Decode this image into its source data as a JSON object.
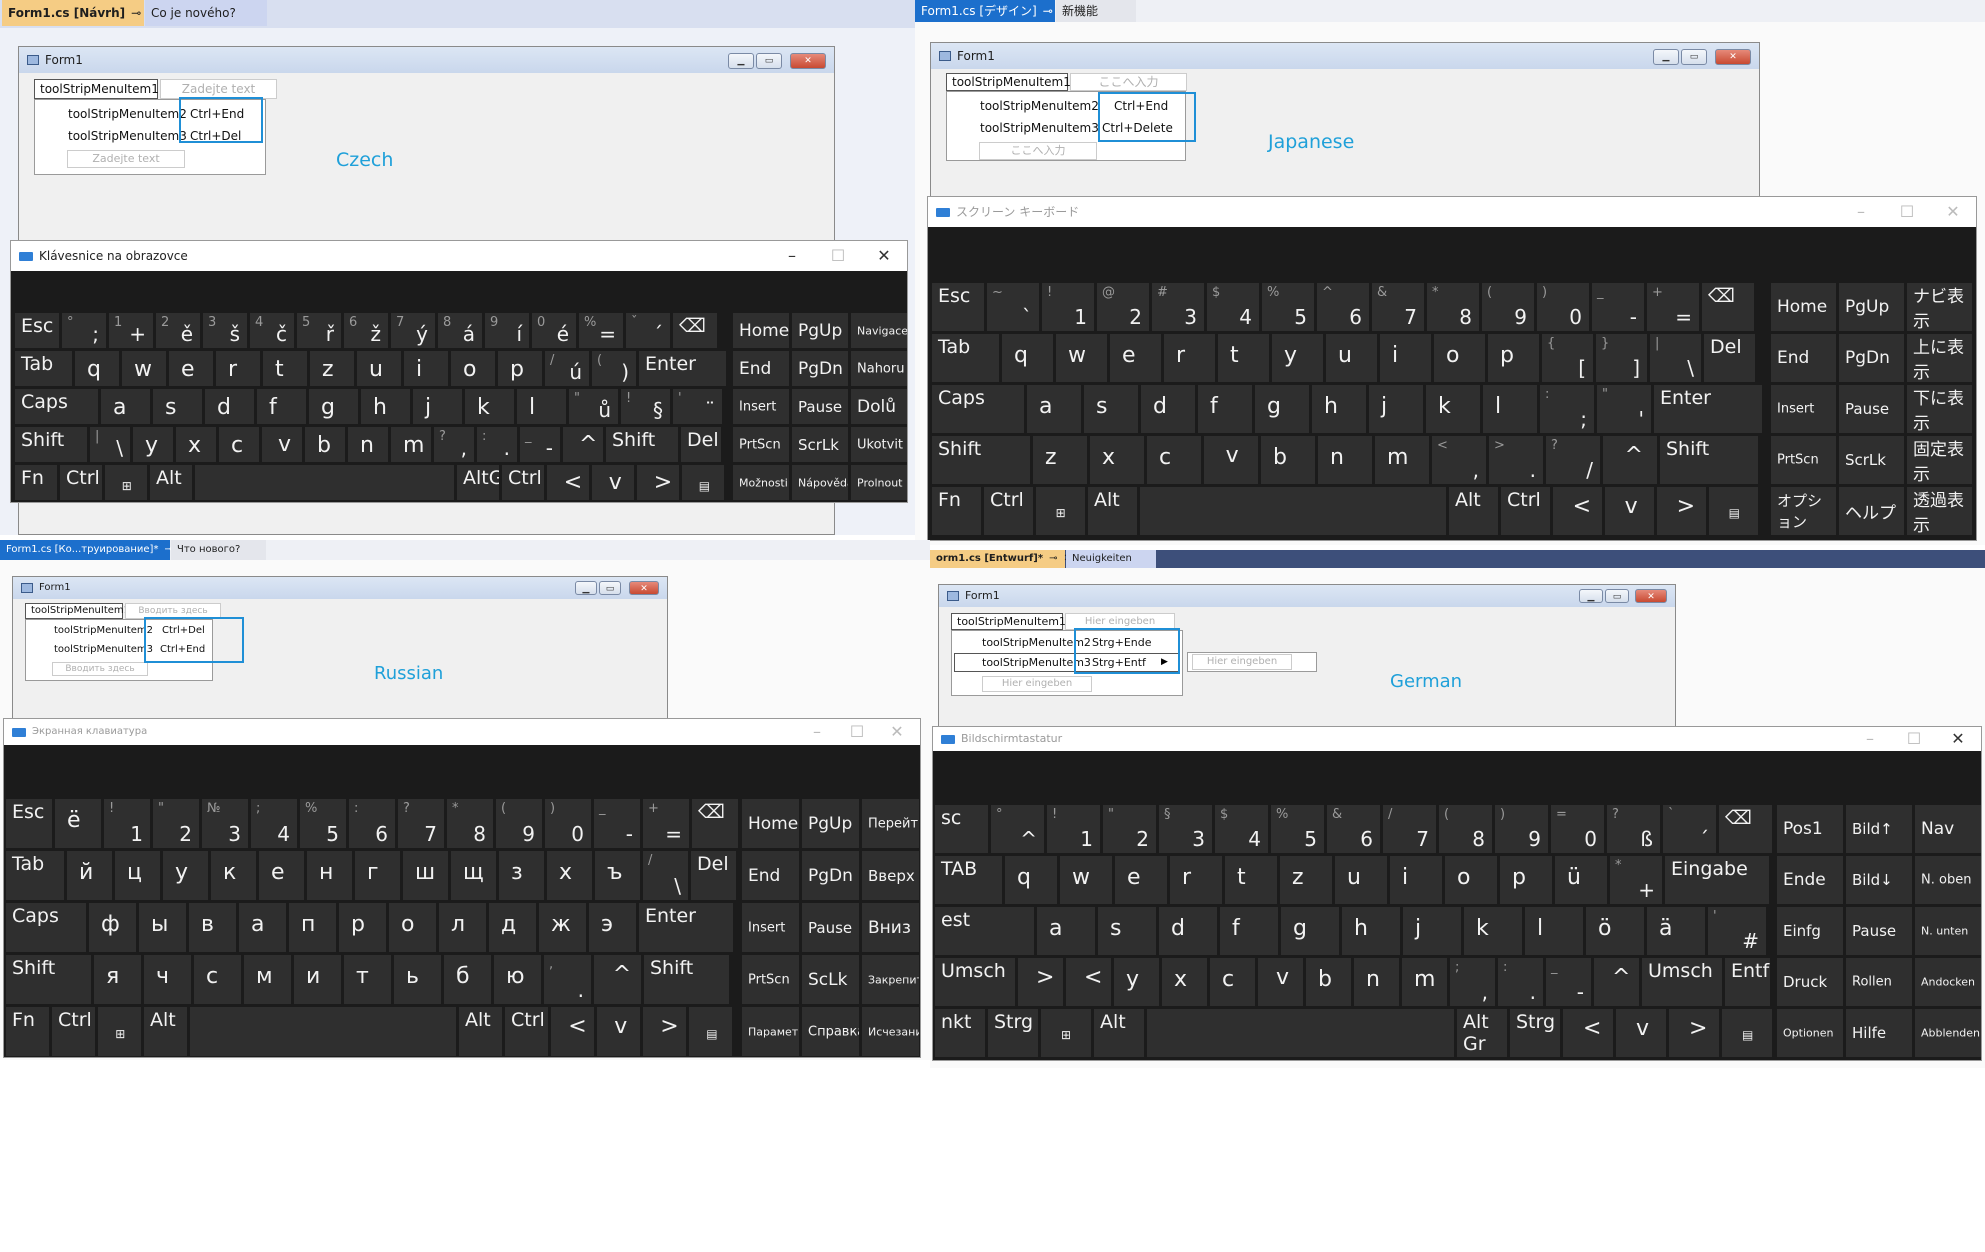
{
  "panels": {
    "czech": {
      "tabs": [
        "Form1.cs [Návrh]",
        "Co je nového?"
      ],
      "form_title": "Form1",
      "menu": {
        "item1": "toolStripMenuItem1",
        "placeholder": "Zadejte text"
      },
      "dropdown": [
        {
          "label": "toolStripMenuItem2",
          "shortcut": "Ctrl+End"
        },
        {
          "label": "toolStripMenuItem3",
          "shortcut": "Ctrl+Del"
        }
      ],
      "dropdown_placeholder": "Zadejte text",
      "language_label": "Czech",
      "osk_title": "Klávesnice na obrazovce",
      "keys": {
        "row1": [
          "Esc",
          "°;",
          "1+",
          "2ě",
          "3š",
          "4č",
          "5ř",
          "6ž",
          "7ý",
          "8á",
          "9í",
          "0é",
          "%=",
          "ˇ´",
          "⌫"
        ],
        "row2": [
          "Tab",
          "q",
          "w",
          "e",
          "r",
          "t",
          "z",
          "u",
          "i",
          "o",
          "p",
          "/ú",
          "()",
          "Enter"
        ],
        "row3": [
          "Caps",
          "a",
          "s",
          "d",
          "f",
          "g",
          "h",
          "j",
          "k",
          "l",
          "\"ů",
          "!§",
          "'¨"
        ],
        "row4": [
          "Shift",
          "|\\",
          "y",
          "x",
          "c",
          "v",
          "b",
          "n",
          "m",
          "?,",
          ":.",
          "_-",
          "^",
          "Shift",
          "Del"
        ],
        "row5": [
          "Fn",
          "Ctrl",
          "⊞",
          "Alt",
          "AltGr",
          "Ctrl",
          "<",
          "v",
          ">",
          "▤"
        ],
        "nav": [
          "Home",
          "PgUp",
          "Navigace",
          "End",
          "PgDn",
          "Nahoru",
          "Insert",
          "Pause",
          "Dolů",
          "PrtScn",
          "ScrLk",
          "Ukotvit",
          "Možnosti",
          "Nápověda",
          "Prolnout"
        ]
      }
    },
    "japanese": {
      "tabs": [
        "Form1.cs [デザイン]",
        "新機能"
      ],
      "form_title": "Form1",
      "menu": {
        "item1": "toolStripMenuItem1",
        "placeholder": "ここへ入力"
      },
      "dropdown": [
        {
          "label": "toolStripMenuItem2",
          "shortcut": "Ctrl+End"
        },
        {
          "label": "toolStripMenuItem3",
          "shortcut": "Ctrl+Delete"
        }
      ],
      "dropdown_placeholder": "ここへ入力",
      "language_label": "Japanese",
      "osk_title": "スクリーン キーボード",
      "keys": {
        "row1": [
          "Esc",
          "~`",
          "!1",
          "@2",
          "#3",
          "$4",
          "%5",
          "^6",
          "&7",
          "*8",
          "(9",
          ")0",
          "_-",
          "+=",
          "⌫"
        ],
        "row2": [
          "Tab",
          "q",
          "w",
          "e",
          "r",
          "t",
          "y",
          "u",
          "i",
          "o",
          "p",
          "{[",
          "}]",
          "|\\",
          "Del"
        ],
        "row3": [
          "Caps",
          "a",
          "s",
          "d",
          "f",
          "g",
          "h",
          "j",
          "k",
          "l",
          ":;",
          "\"'",
          "Enter"
        ],
        "row4": [
          "Shift",
          "z",
          "x",
          "c",
          "v",
          "b",
          "n",
          "m",
          "<,",
          ">.",
          "?/",
          "^",
          "Shift"
        ],
        "row5": [
          "Fn",
          "Ctrl",
          "⊞",
          "Alt",
          "Alt",
          "Ctrl",
          "<",
          "v",
          ">",
          "▤"
        ],
        "nav": [
          "Home",
          "PgUp",
          "ナビ表示",
          "End",
          "PgDn",
          "上に表示",
          "Insert",
          "Pause",
          "下に表示",
          "PrtScn",
          "ScrLk",
          "固定表示",
          "オプション",
          "ヘルプ",
          "透過表示"
        ]
      }
    },
    "russian": {
      "tabs": [
        "Form1.cs [Ко...труирование]*",
        "Что нового?"
      ],
      "form_title": "Form1",
      "menu": {
        "item1": "toolStripMenuItem1",
        "placeholder": "Вводить здесь"
      },
      "dropdown": [
        {
          "label": "toolStripMenuItem2",
          "shortcut": "Ctrl+Del"
        },
        {
          "label": "toolStripMenuItem3",
          "shortcut": "Ctrl+End"
        }
      ],
      "dropdown_placeholder": "Вводить здесь",
      "language_label": "Russian",
      "osk_title": "Экранная клавиатура",
      "keys": {
        "row1": [
          "Esc",
          "ё",
          "!1",
          "\"2",
          "№3",
          ";4",
          "%5",
          ":6",
          "?7",
          "*8",
          "(9",
          ")0",
          "_-",
          "+=",
          "⌫"
        ],
        "row2": [
          "Tab",
          "й",
          "ц",
          "у",
          "к",
          "е",
          "н",
          "г",
          "ш",
          "щ",
          "з",
          "х",
          "ъ",
          "/\\",
          "Del"
        ],
        "row3": [
          "Caps",
          "ф",
          "ы",
          "в",
          "а",
          "п",
          "р",
          "о",
          "л",
          "д",
          "ж",
          "э",
          "Enter"
        ],
        "row4": [
          "Shift",
          "я",
          "ч",
          "с",
          "м",
          "и",
          "т",
          "ь",
          "б",
          "ю",
          ",.",
          "^",
          "Shift"
        ],
        "row5": [
          "Fn",
          "Ctrl",
          "⊞",
          "Alt",
          "Alt",
          "Ctrl",
          "<",
          "v",
          ">",
          "▤"
        ],
        "nav": [
          "Home",
          "PgUp",
          "Перейти",
          "End",
          "PgDn",
          "Вверх",
          "Insert",
          "Pause",
          "Вниз",
          "PrtScn",
          "ScLk",
          "Закрепить",
          "Параметры",
          "Справка",
          "Исчезание"
        ]
      }
    },
    "german": {
      "tabs": [
        "orm1.cs [Entwurf]*",
        "Neuigkeiten"
      ],
      "form_title": "Form1",
      "menu": {
        "item1": "toolStripMenuItem1",
        "placeholder": "Hier eingeben"
      },
      "dropdown": [
        {
          "label": "toolStripMenuItem2",
          "shortcut": "Strg+Ende"
        },
        {
          "label": "toolStripMenuItem3",
          "shortcut": "Strg+Entf"
        }
      ],
      "dropdown_placeholder": "Hier eingeben",
      "submenu_placeholder": "Hier eingeben",
      "language_label": "German",
      "osk_title": "Bildschirmtastatur",
      "keys": {
        "row1": [
          "sc",
          "°^",
          "!1",
          "\"2",
          "§3",
          "$4",
          "%5",
          "&6",
          "/7",
          "(8",
          ")9",
          "=0",
          "?ß",
          "`´",
          "⌫"
        ],
        "row2": [
          "TAB",
          "q",
          "w",
          "e",
          "r",
          "t",
          "z",
          "u",
          "i",
          "o",
          "p",
          "ü",
          "*+",
          "Eingabe"
        ],
        "row3": [
          "est",
          "a",
          "s",
          "d",
          "f",
          "g",
          "h",
          "j",
          "k",
          "l",
          "ö",
          "ä",
          "'#"
        ],
        "row4": [
          "Umsch",
          ">",
          "<",
          "y",
          "x",
          "c",
          "v",
          "b",
          "n",
          "m",
          ";,",
          ":.",
          "_-",
          "^",
          "Umsch",
          "Entf"
        ],
        "row5": [
          "nkt",
          "Strg",
          "⊞",
          "Alt",
          "Alt Gr",
          "Strg",
          "<",
          "v",
          ">",
          "▤"
        ],
        "nav": [
          "Pos1",
          "Bild↑",
          "Nav",
          "Ende",
          "Bild↓",
          "N. oben",
          "Einfg",
          "Pause",
          "N. unten",
          "Druck",
          "Rollen",
          "Andocken",
          "Optionen",
          "Hilfe",
          "Abblenden"
        ]
      }
    }
  },
  "colors": {
    "highlight": "#1f8fd6",
    "label": "#1fa0d9",
    "keyboard_bg": "#1b1b1b",
    "key": "#2f2f2f"
  }
}
